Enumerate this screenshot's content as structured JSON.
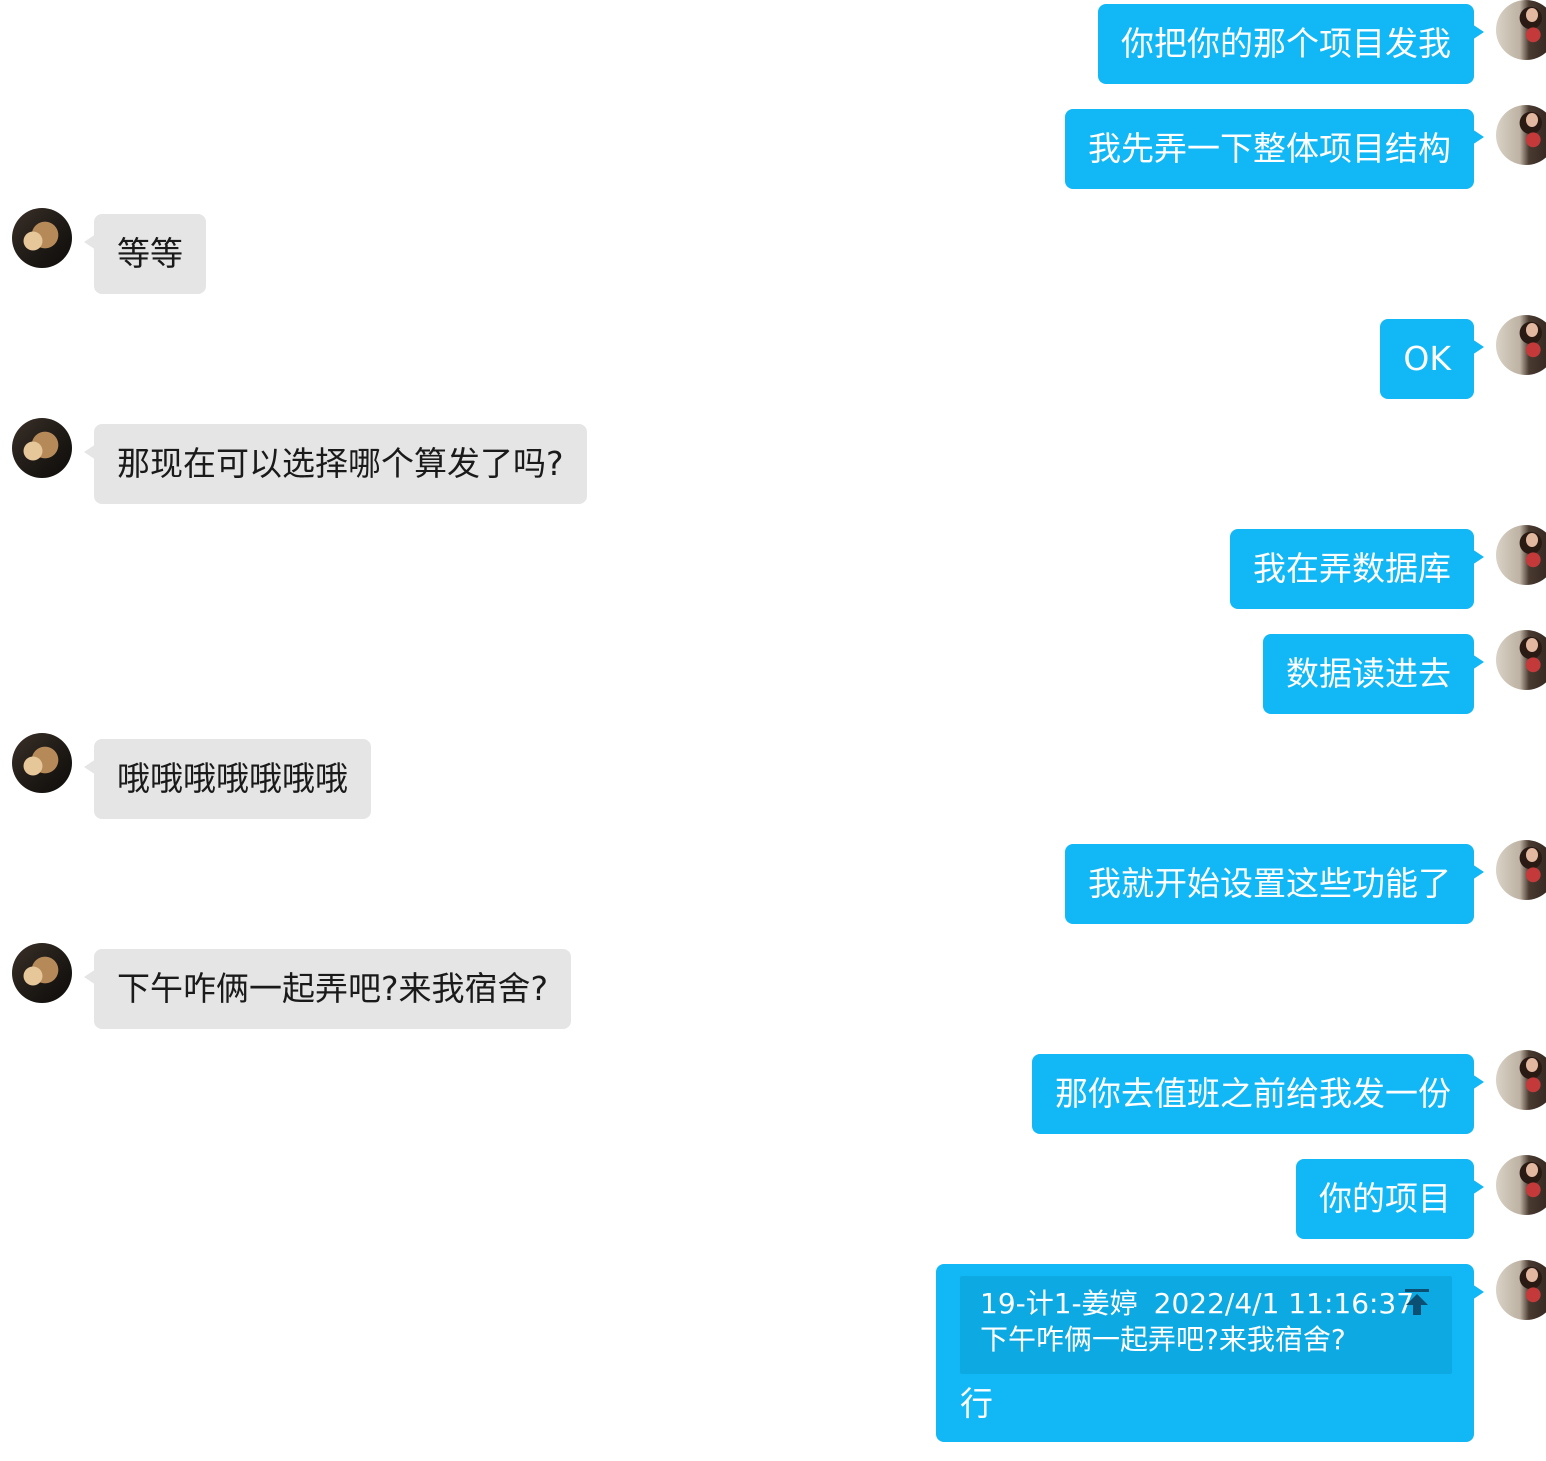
{
  "messages": [
    {
      "side": "me",
      "text": "你把你的那个项目发我"
    },
    {
      "side": "me",
      "text": "我先弄一下整体项目结构"
    },
    {
      "side": "them",
      "text": "等等"
    },
    {
      "side": "me",
      "text": "OK"
    },
    {
      "side": "them",
      "text": "那现在可以选择哪个算发了吗?"
    },
    {
      "side": "me",
      "text": "我在弄数据库"
    },
    {
      "side": "me",
      "text": "数据读进去"
    },
    {
      "side": "them",
      "text": "哦哦哦哦哦哦哦"
    },
    {
      "side": "me",
      "text": "我就开始设置这些功能了"
    },
    {
      "side": "them",
      "text": "下午咋俩一起弄吧?来我宿舍?"
    },
    {
      "side": "me",
      "text": "那你去值班之前给我发一份"
    },
    {
      "side": "me",
      "text": "你的项目"
    }
  ],
  "reply": {
    "quoted_sender": "19-计1-姜婷",
    "quoted_time": "2022/4/1 11:16:37",
    "quoted_text": "下午咋俩一起弄吧?来我宿舍?",
    "text": "行",
    "jump_icon": "jump-to-original-icon"
  },
  "colors": {
    "outgoing_bubble": "#12b7f5",
    "incoming_bubble": "#e5e5e5",
    "quote_background": "#0da9e3"
  }
}
